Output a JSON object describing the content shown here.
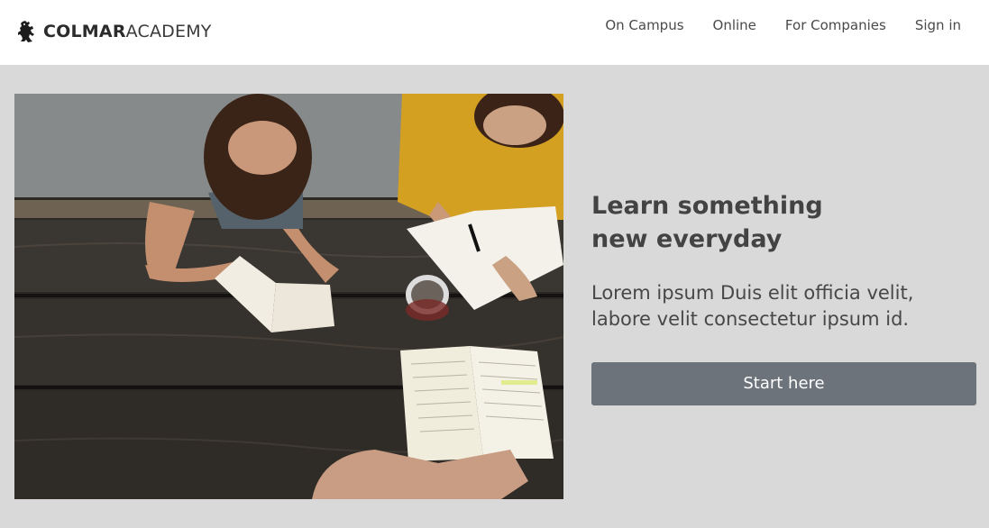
{
  "brand": {
    "name_bold": "COLMAR",
    "name_light": "ACADEMY",
    "logo_icon": "lion-rampant-icon"
  },
  "nav": {
    "items": [
      {
        "label": "On Campus"
      },
      {
        "label": "Online"
      },
      {
        "label": "For Companies"
      },
      {
        "label": "Sign in"
      }
    ]
  },
  "hero": {
    "image": "photo of students reading books at a wooden picnic table",
    "headline_line1": "Learn something",
    "headline_line2": "new everyday",
    "tagline_line1": "Lorem ipsum Duis elit officia velit,",
    "tagline_line2": "labore velit consectetur ipsum id.",
    "cta_label": "Start here"
  },
  "colors": {
    "background": "#d9d9d9",
    "navbar": "#ffffff",
    "button": "#6c737b",
    "button_text": "#ffffff",
    "text": "#434343"
  }
}
